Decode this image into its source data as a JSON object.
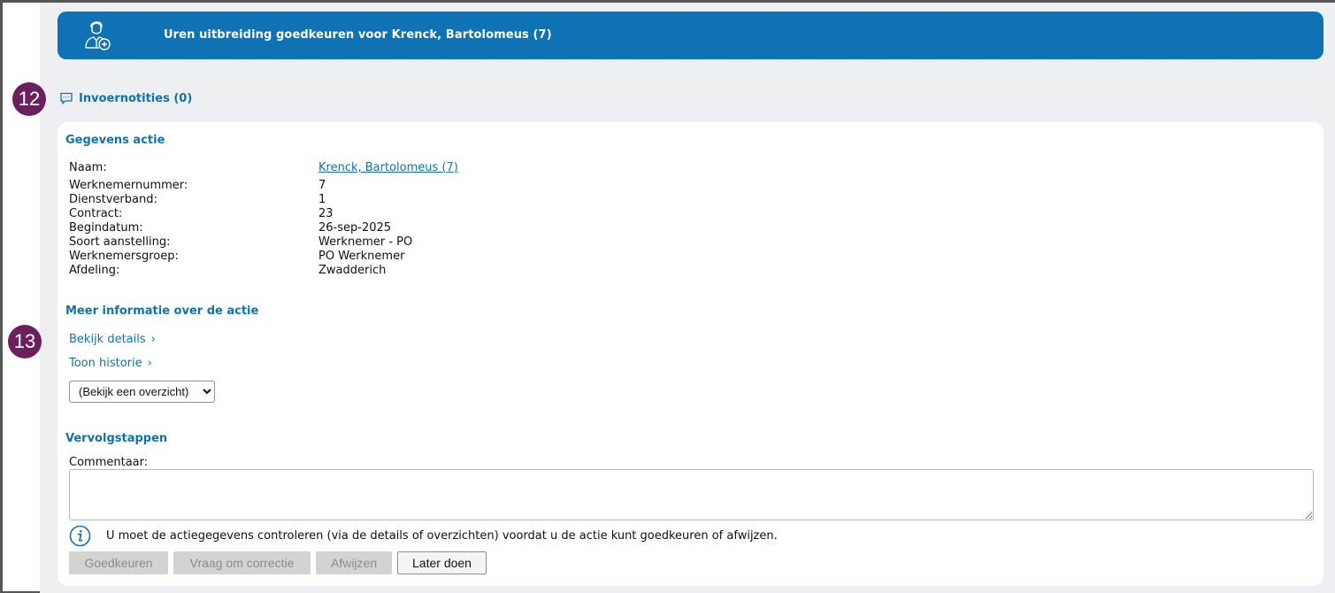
{
  "header": {
    "title": "Uren uitbreiding goedkeuren voor Krenck, Bartolomeus (7)",
    "icon": "user-add-icon",
    "color": "#0e72b4"
  },
  "badges": {
    "step12": "12",
    "step13": "13",
    "color": "#6b1f5c"
  },
  "notes": {
    "label": "Invoernotities (0)",
    "icon": "comment-icon"
  },
  "gegevens": {
    "title": "Gegevens actie",
    "rows": [
      {
        "label": "Naam:",
        "value": "Krenck, Bartolomeus (7)",
        "is_link": true
      },
      {
        "label": "Werknemernummer:",
        "value": "7"
      },
      {
        "label": "Dienstverband:",
        "value": "1"
      },
      {
        "label": "Contract:",
        "value": "23"
      },
      {
        "label": "Begindatum:",
        "value": "26-sep-2025"
      },
      {
        "label": "Soort aanstelling:",
        "value": "Werknemer - PO"
      },
      {
        "label": "Werknemersgroep:",
        "value": "PO Werknemer"
      },
      {
        "label": "Afdeling:",
        "value": "Zwadderich"
      }
    ]
  },
  "meer_info": {
    "title": "Meer informatie over de actie",
    "details_link": "Bekijk details",
    "historie_link": "Toon historie",
    "chevron": "›",
    "select_value": "(Bekijk een overzicht)"
  },
  "vervolg": {
    "title": "Vervolgstappen",
    "comment_label": "Commentaar:",
    "comment_value": "",
    "notice": "U moet de actiegegevens controleren (via de details of overzichten) voordat u de actie kunt goedkeuren of afwijzen.",
    "notice_icon": "info-icon",
    "buttons": {
      "approve": "Goedkeuren",
      "correction": "Vraag om correctie",
      "reject": "Afwijzen",
      "later": "Later doen"
    }
  }
}
